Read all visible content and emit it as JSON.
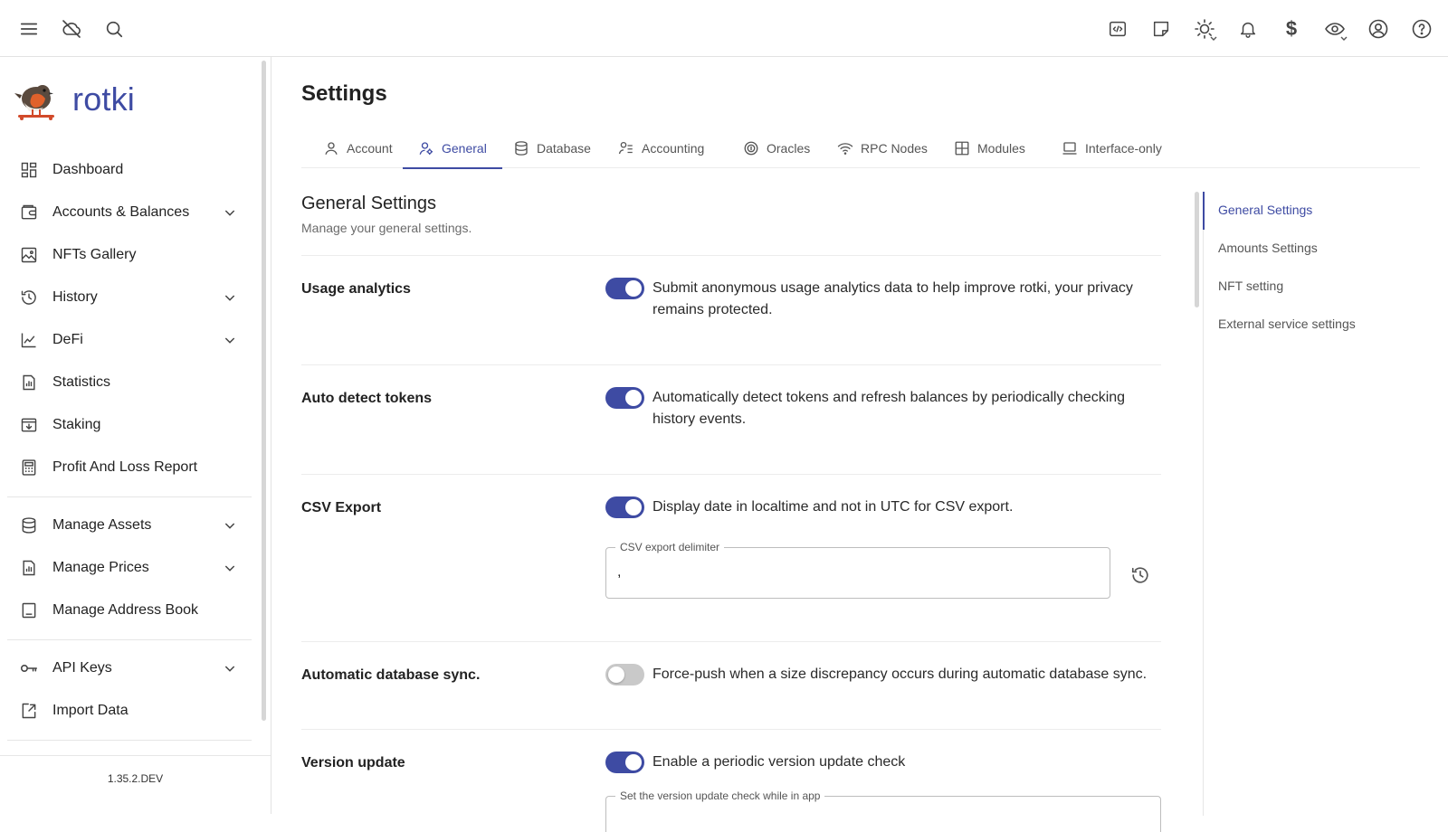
{
  "app": {
    "name": "rotki",
    "version": "1.35.2.DEV"
  },
  "colors": {
    "accent": "#3e4ba3",
    "switch_off": "#c9c9c9"
  },
  "topbar": {
    "left_icons": [
      "menu-icon",
      "cloud-off-icon",
      "search-icon"
    ],
    "right_icons": [
      "code-icon",
      "note-icon",
      "theme-icon",
      "bell-icon",
      "currency-icon",
      "eye-icon",
      "account-icon",
      "help-icon"
    ],
    "currency_symbol": "$"
  },
  "sidebar": {
    "items": [
      {
        "label": "Dashboard",
        "icon": "dashboard-icon",
        "expandable": false
      },
      {
        "label": "Accounts & Balances",
        "icon": "wallet-icon",
        "expandable": true
      },
      {
        "label": "NFTs Gallery",
        "icon": "image-icon",
        "expandable": false
      },
      {
        "label": "History",
        "icon": "history-icon",
        "expandable": true
      },
      {
        "label": "DeFi",
        "icon": "chart-line-icon",
        "expandable": true
      },
      {
        "label": "Statistics",
        "icon": "statistics-icon",
        "expandable": false
      },
      {
        "label": "Staking",
        "icon": "staking-icon",
        "expandable": false
      },
      {
        "label": "Profit And Loss Report",
        "icon": "calculator-icon",
        "expandable": false
      },
      {
        "label": "Manage Assets",
        "icon": "database-icon",
        "expandable": true
      },
      {
        "label": "Manage Prices",
        "icon": "prices-icon",
        "expandable": true
      },
      {
        "label": "Manage Address Book",
        "icon": "address-book-icon",
        "expandable": false
      },
      {
        "label": "API Keys",
        "icon": "key-icon",
        "expandable": true
      },
      {
        "label": "Import Data",
        "icon": "import-icon",
        "expandable": false
      }
    ]
  },
  "main": {
    "title": "Settings",
    "tabs": [
      {
        "label": "Account",
        "icon": "user-icon",
        "active": false
      },
      {
        "label": "General",
        "icon": "user-settings-icon",
        "active": true
      },
      {
        "label": "Database",
        "icon": "database-icon",
        "active": false
      },
      {
        "label": "Accounting",
        "icon": "accounting-icon",
        "active": false
      },
      {
        "label": "Oracles",
        "icon": "oracle-icon",
        "active": false
      },
      {
        "label": "RPC Nodes",
        "icon": "wifi-icon",
        "active": false
      },
      {
        "label": "Modules",
        "icon": "modules-icon",
        "active": false
      },
      {
        "label": "Interface-only",
        "icon": "laptop-icon",
        "active": false
      }
    ],
    "section": {
      "title": "General Settings",
      "subtitle": "Manage your general settings."
    },
    "rows": {
      "usage": {
        "label": "Usage analytics",
        "desc": "Submit anonymous usage analytics data to help improve rotki, your privacy remains protected.",
        "enabled": true
      },
      "autodetect": {
        "label": "Auto detect tokens",
        "desc": "Automatically detect tokens and refresh balances by periodically checking history events.",
        "enabled": true
      },
      "csv": {
        "label": "CSV Export",
        "desc": "Display date in localtime and not in UTC for CSV export.",
        "enabled": true,
        "delimiter_label": "CSV export delimiter",
        "delimiter_value": ","
      },
      "dbsync": {
        "label": "Automatic database sync.",
        "desc": "Force-push when a size discrepancy occurs during automatic database sync.",
        "enabled": false
      },
      "version": {
        "label": "Version update",
        "desc": "Enable a periodic version update check",
        "enabled": true,
        "field_label": "Set the version update check while in app"
      }
    }
  },
  "toc": {
    "items": [
      {
        "label": "General Settings",
        "active": true
      },
      {
        "label": "Amounts Settings",
        "active": false
      },
      {
        "label": "NFT setting",
        "active": false
      },
      {
        "label": "External service settings",
        "active": false
      }
    ]
  }
}
